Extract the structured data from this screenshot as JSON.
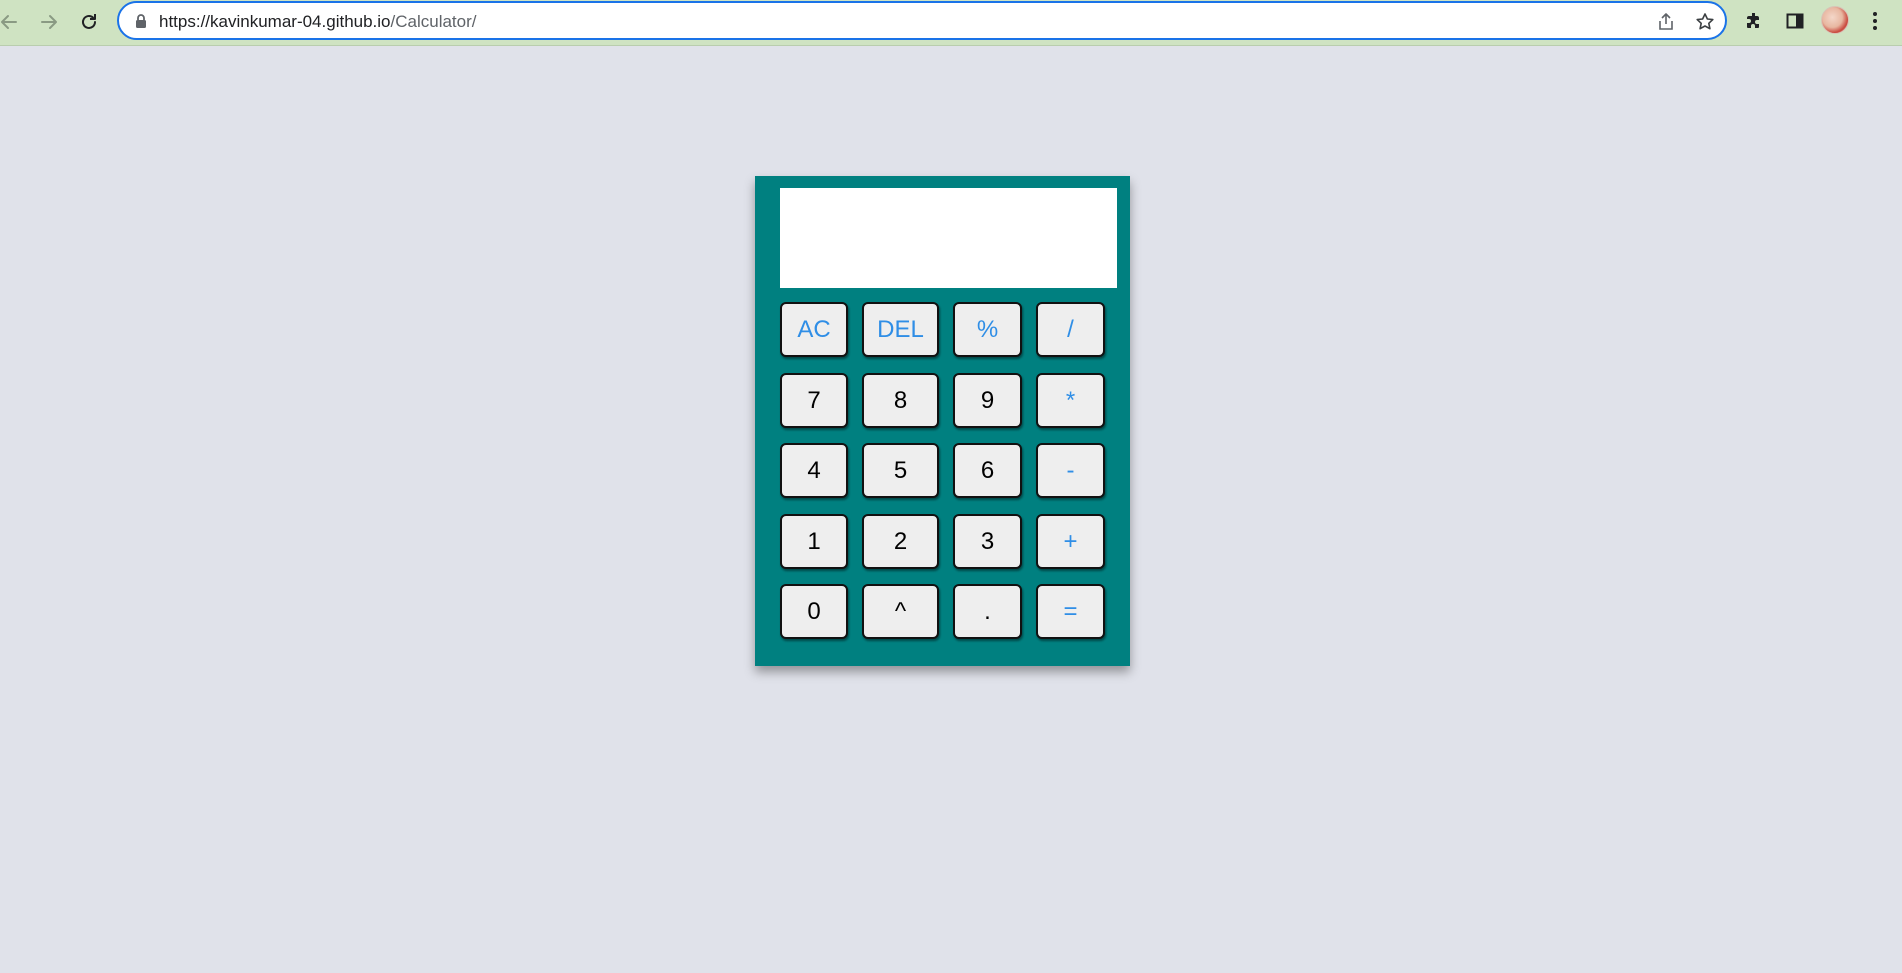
{
  "browser": {
    "url_host": "https://kavinkumar-04.github.io",
    "url_path": "/Calculator/",
    "icons": [
      "back-icon",
      "forward-icon",
      "reload-icon",
      "lock-icon",
      "share-icon",
      "bookmark-star-icon",
      "extensions-icon",
      "side-panel-icon",
      "profile-avatar",
      "more-menu-icon"
    ]
  },
  "calculator": {
    "display_value": "",
    "colors": {
      "body": "#008080",
      "key_bg": "#eeeeee",
      "operator_text": "#2f8ee6",
      "digit_text": "#000000",
      "page_bg": "#e0e2ea"
    },
    "rows": [
      [
        {
          "label": "AC",
          "kind": "op"
        },
        {
          "label": "DEL",
          "kind": "op"
        },
        {
          "label": "%",
          "kind": "op"
        },
        {
          "label": "/",
          "kind": "op"
        }
      ],
      [
        {
          "label": "7",
          "kind": "digit"
        },
        {
          "label": "8",
          "kind": "digit"
        },
        {
          "label": "9",
          "kind": "digit"
        },
        {
          "label": "*",
          "kind": "op"
        }
      ],
      [
        {
          "label": "4",
          "kind": "digit"
        },
        {
          "label": "5",
          "kind": "digit"
        },
        {
          "label": "6",
          "kind": "digit"
        },
        {
          "label": "-",
          "kind": "op"
        }
      ],
      [
        {
          "label": "1",
          "kind": "digit"
        },
        {
          "label": "2",
          "kind": "digit"
        },
        {
          "label": "3",
          "kind": "digit"
        },
        {
          "label": "+",
          "kind": "op"
        }
      ],
      [
        {
          "label": "0",
          "kind": "digit"
        },
        {
          "label": "^",
          "kind": "digit"
        },
        {
          "label": ".",
          "kind": "digit"
        },
        {
          "label": "=",
          "kind": "op"
        }
      ]
    ]
  }
}
